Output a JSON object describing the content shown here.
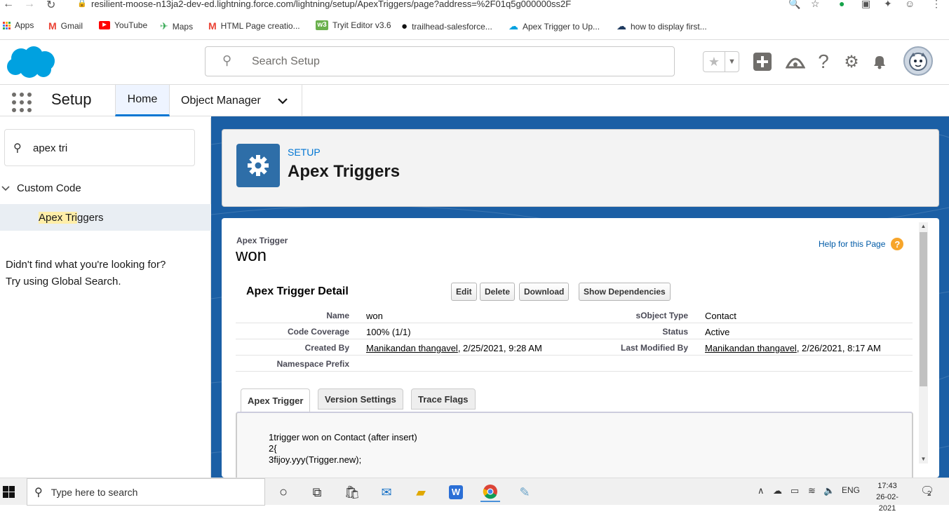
{
  "browser": {
    "url": "resilient-moose-n13ja2-dev-ed.lightning.force.com/lightning/setup/ApexTriggers/page?address=%2F01q5g000000ss2F",
    "bookmarks": [
      "Apps",
      "Gmail",
      "YouTube",
      "Maps",
      "HTML Page creatio...",
      "Tryit Editor v3.6",
      "trailhead-salesforce...",
      "Apex Trigger to Up...",
      "how to display first..."
    ]
  },
  "header": {
    "search_placeholder": "Search Setup"
  },
  "nav": {
    "app_title": "Setup",
    "tab_home": "Home",
    "tab_object_manager": "Object Manager"
  },
  "sidebar": {
    "quick_find_value": "apex tri",
    "section": "Custom Code",
    "item_highlight": "Apex Tri",
    "item_rest": "ggers",
    "not_found_line1": "Didn't find what you're looking for?",
    "not_found_line2": "Try using Global Search."
  },
  "page_header": {
    "breadcrumb": "SETUP",
    "title": "Apex Triggers"
  },
  "record": {
    "type": "Apex Trigger",
    "name": "won",
    "help": "Help for this Page",
    "section_title": "Apex Trigger Detail",
    "buttons": [
      "Edit",
      "Delete",
      "Download",
      "Show Dependencies"
    ],
    "fields": {
      "name_label": "Name",
      "name_value": "won",
      "sobject_label": "sObject Type",
      "sobject_value": "Contact",
      "coverage_label": "Code Coverage",
      "coverage_value": "100% (1/1)",
      "status_label": "Status",
      "status_value": "Active",
      "created_label": "Created By",
      "created_user": "Manikandan thangavel",
      "created_date": ", 2/25/2021, 9:28 AM",
      "modified_label": "Last Modified By",
      "modified_user": "Manikandan thangavel",
      "modified_date": ", 2/26/2021, 8:17 AM",
      "namespace_label": "Namespace Prefix"
    },
    "tabs": [
      "Apex Trigger",
      "Version Settings",
      "Trace Flags"
    ],
    "code_lines": [
      "1trigger won on Contact (after insert)",
      "2{",
      "3fijoy.yyy(Trigger.new);"
    ]
  },
  "taskbar": {
    "search_placeholder": "Type here to search",
    "language": "ENG",
    "time": "17:43",
    "date": "26-02-2021",
    "notification_count": "2"
  }
}
